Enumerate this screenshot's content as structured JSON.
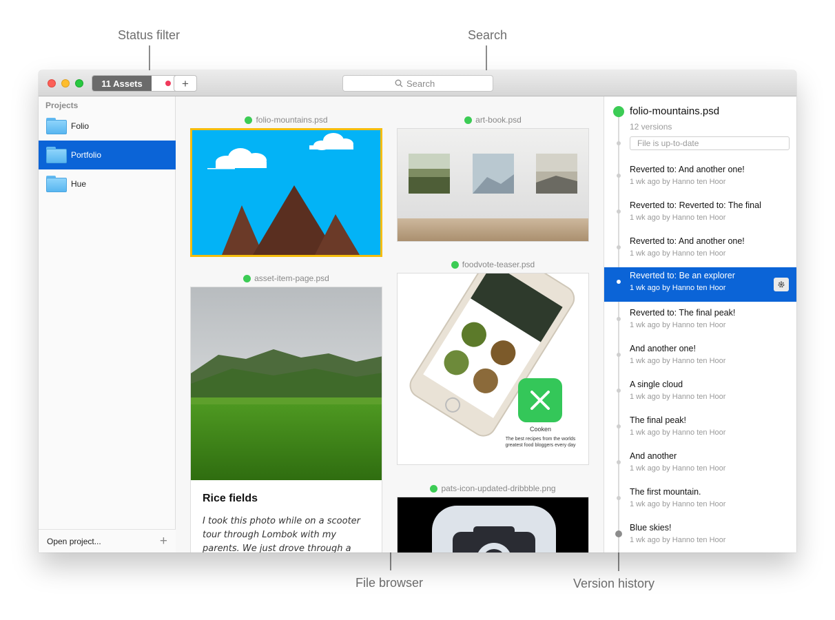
{
  "annotations": {
    "status_filter": "Status filter",
    "search": "Search",
    "file_browser": "File browser",
    "version_history": "Version history"
  },
  "toolbar": {
    "assets_count_label": "11 Assets",
    "add_label": "+",
    "search_placeholder": "Search"
  },
  "sidebar": {
    "heading": "Projects",
    "items": [
      {
        "label": "Folio",
        "active": false
      },
      {
        "label": "Portfolio",
        "active": true
      },
      {
        "label": "Hue",
        "active": false
      }
    ],
    "footer_label": "Open project...",
    "footer_add": "+"
  },
  "assets": [
    {
      "name": "folio-mountains.psd",
      "selected": true
    },
    {
      "name": "art-book.psd",
      "selected": false
    },
    {
      "name": "asset-item-page.psd",
      "selected": false
    },
    {
      "name": "foodvote-teaser.psd",
      "selected": false
    },
    {
      "name": "pats-icon-updated-dribbble.png",
      "selected": false
    }
  ],
  "asset_card": {
    "title": "Rice fields",
    "body": "I took this photo while on a scooter tour through Lombok with my parents. We just drove through a huge rain"
  },
  "foodvote": {
    "app_name": "Cooken",
    "tagline": "The best recipes from the worlds greatest food bloggers every day"
  },
  "history": {
    "file_name": "folio-mountains.psd",
    "version_count": "12 versions",
    "status": "File is up-to-date",
    "versions": [
      {
        "title": "Reverted to: And another one!",
        "meta": "1 wk ago by Hanno ten Hoor",
        "active": false
      },
      {
        "title": "Reverted to: Reverted to: The final",
        "meta": "1 wk ago by Hanno ten Hoor",
        "active": false
      },
      {
        "title": "Reverted to: And another one!",
        "meta": "1 wk ago by Hanno ten Hoor",
        "active": false
      },
      {
        "title": "Reverted to: Be an explorer",
        "meta": "1 wk ago by Hanno ten Hoor",
        "active": true
      },
      {
        "title": "Reverted to: The final peak!",
        "meta": "1 wk ago by Hanno ten Hoor",
        "active": false
      },
      {
        "title": "And another one!",
        "meta": "1 wk ago by Hanno ten Hoor",
        "active": false
      },
      {
        "title": "A single cloud",
        "meta": "1 wk ago by Hanno ten Hoor",
        "active": false
      },
      {
        "title": "The final peak!",
        "meta": "1 wk ago by Hanno ten Hoor",
        "active": false
      },
      {
        "title": "And another",
        "meta": "1 wk ago by Hanno ten Hoor",
        "active": false
      },
      {
        "title": "The first mountain.",
        "meta": "1 wk ago by Hanno ten Hoor",
        "active": false
      },
      {
        "title": "Blue skies!",
        "meta": "1 wk ago by Hanno ten Hoor",
        "active": false
      }
    ]
  },
  "colors": {
    "accent": "#0b64d7",
    "status_ok": "#3ccc55",
    "status_alert": "#f03a5b",
    "selection": "#f5bd0d"
  }
}
